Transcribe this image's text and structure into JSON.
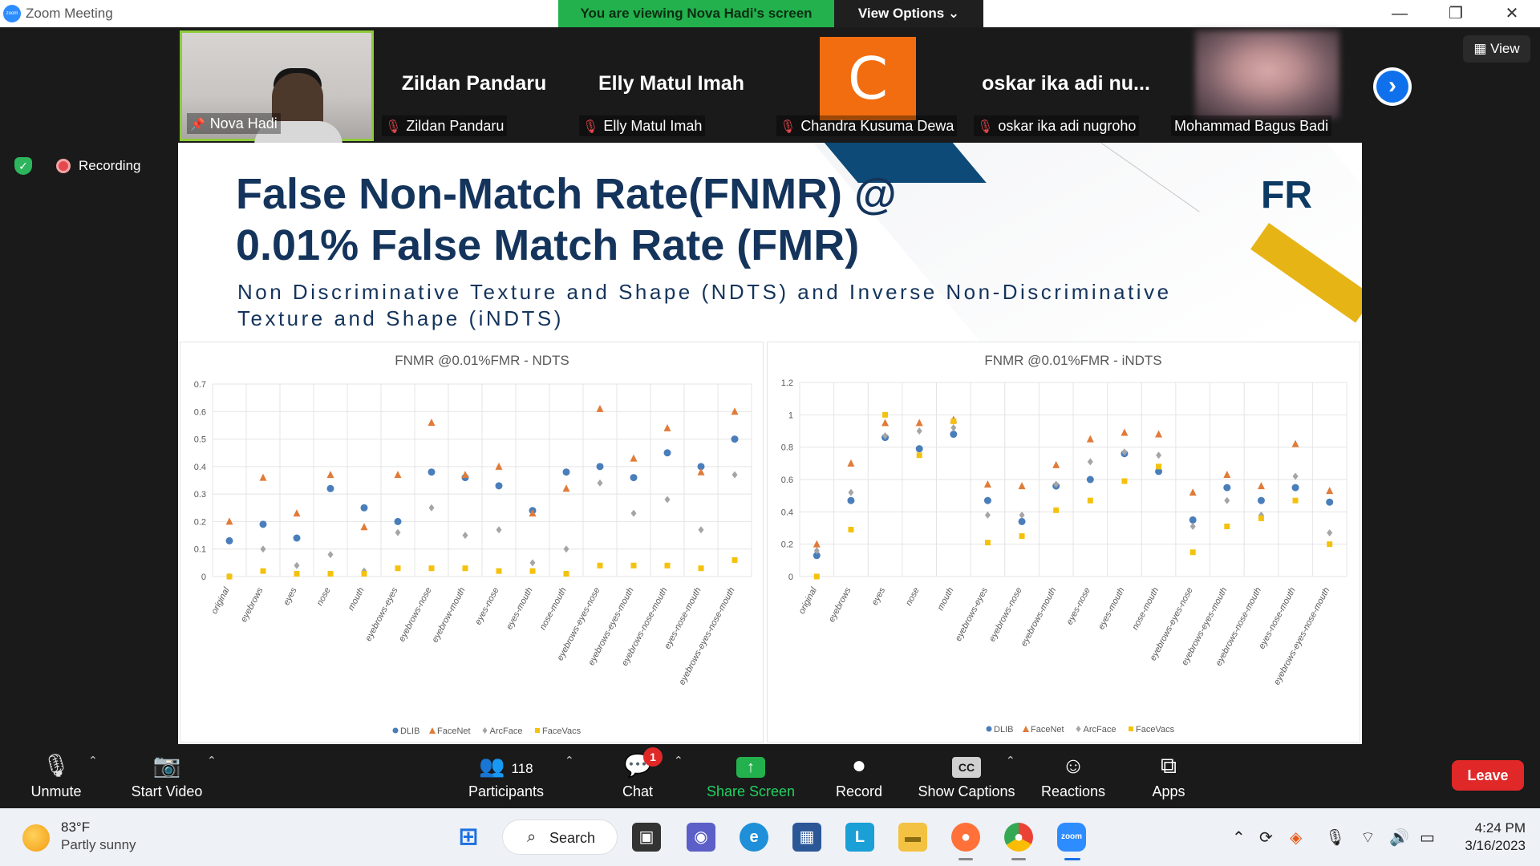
{
  "window": {
    "title": "Zoom Meeting",
    "app_logo_text": "zoom",
    "banner": "You are viewing Nova Hadi's screen",
    "view_options": "View Options",
    "minimize": "—",
    "maximize": "❐",
    "close": "✕"
  },
  "gallery": {
    "view_label": "View",
    "tiles": [
      {
        "name": "Nova Hadi",
        "big": ""
      },
      {
        "name": "Zildan Pandaru",
        "big": "Zildan Pandaru"
      },
      {
        "name": "Elly Matul Imah",
        "big": "Elly Matul Imah"
      },
      {
        "name": "Chandra Kusuma Dewa",
        "big": "",
        "avatar_letter": "C"
      },
      {
        "name": "oskar ika adi nugroho",
        "big": "oskar ika adi nu..."
      },
      {
        "name": "Mohammad Bagus Badi",
        "big": ""
      }
    ],
    "next_icon": "›"
  },
  "recording": {
    "label": "Recording"
  },
  "slide": {
    "title_line1": "False Non-Match Rate(FNMR) @",
    "title_line2": "0.01% False Match Rate (FMR)",
    "subtitle": "Non Discriminative Texture and Shape (NDTS) and Inverse Non-Discriminative Texture and Shape (iNDTS)",
    "logo": "FR"
  },
  "colors": {
    "DLIB": "#4a7ebb",
    "FaceNet": "#e07b39",
    "ArcFace": "#a5a5a5",
    "FaceVacs": "#f4c20d"
  },
  "chart_data": [
    {
      "type": "scatter",
      "title": "FNMR @0.01%FMR - NDTS",
      "ylim": [
        0,
        0.7
      ],
      "yticks": [
        0,
        0.1,
        0.2,
        0.3,
        0.4,
        0.5,
        0.6,
        0.7
      ],
      "categories": [
        "original",
        "eyebrows",
        "eyes",
        "nose",
        "mouth",
        "eyebrows-eyes",
        "eyebrows-nose",
        "eyebrow-mouth",
        "eyes-nose",
        "eyes-mouth",
        "nose-mouth",
        "eyebrows-eyes-nose",
        "eyebrows-eyes-mouth",
        "eyebrows-nose-mouth",
        "eyes-nose-mouth",
        "eyebrows-eyes-nose-mouth"
      ],
      "grid": true,
      "legend": "bottom",
      "series": [
        {
          "name": "DLIB",
          "marker": "circle",
          "values": [
            0.13,
            0.19,
            0.14,
            0.32,
            0.25,
            0.2,
            0.38,
            0.36,
            0.33,
            0.24,
            0.38,
            0.4,
            0.36,
            0.45,
            0.4,
            0.5
          ]
        },
        {
          "name": "FaceNet",
          "marker": "triangle",
          "values": [
            0.2,
            0.36,
            0.23,
            0.37,
            0.18,
            0.37,
            0.56,
            0.37,
            0.4,
            0.23,
            0.32,
            0.61,
            0.43,
            0.54,
            0.38,
            0.6
          ]
        },
        {
          "name": "ArcFace",
          "marker": "diamond",
          "values": [
            0.0,
            0.1,
            0.04,
            0.08,
            0.02,
            0.16,
            0.25,
            0.15,
            0.17,
            0.05,
            0.1,
            0.34,
            0.23,
            0.28,
            0.17,
            0.37
          ]
        },
        {
          "name": "FaceVacs",
          "marker": "square",
          "values": [
            0.0,
            0.02,
            0.01,
            0.01,
            0.01,
            0.03,
            0.03,
            0.03,
            0.02,
            0.02,
            0.01,
            0.04,
            0.04,
            0.04,
            0.03,
            0.06
          ]
        }
      ]
    },
    {
      "type": "scatter",
      "title": "FNMR @0.01%FMR - iNDTS",
      "ylim": [
        0,
        1.2
      ],
      "yticks": [
        0,
        0.2,
        0.4,
        0.6,
        0.8,
        1,
        1.2
      ],
      "categories": [
        "original",
        "eyebrows",
        "eyes",
        "nose",
        "mouth",
        "eyebrows-eyes",
        "eyebrows-nose",
        "eyebrows-mouth",
        "eyes-nose",
        "eyes-mouth",
        "nose-mouth",
        "eyebrows-eyes-nose",
        "eyebrows-eyes-mouth",
        "eyebrows-nose-mouth",
        "eyes-nose-mouth",
        "eyebrows-eyes-nose-mouth"
      ],
      "grid": true,
      "legend": "bottom",
      "series": [
        {
          "name": "DLIB",
          "marker": "circle",
          "values": [
            0.13,
            0.47,
            0.86,
            0.79,
            0.88,
            0.47,
            0.34,
            0.56,
            0.6,
            0.76,
            0.65,
            0.35,
            0.55,
            0.47,
            0.55,
            0.46
          ]
        },
        {
          "name": "FaceNet",
          "marker": "triangle",
          "values": [
            0.2,
            0.7,
            0.95,
            0.95,
            0.97,
            0.57,
            0.56,
            0.69,
            0.85,
            0.89,
            0.88,
            0.52,
            0.63,
            0.56,
            0.82,
            0.53
          ]
        },
        {
          "name": "ArcFace",
          "marker": "diamond",
          "values": [
            0.16,
            0.52,
            0.87,
            0.9,
            0.92,
            0.38,
            0.38,
            0.57,
            0.71,
            0.77,
            0.75,
            0.31,
            0.47,
            0.38,
            0.62,
            0.27
          ]
        },
        {
          "name": "FaceVacs",
          "marker": "square",
          "values": [
            0.0,
            0.29,
            1.0,
            0.75,
            0.96,
            0.21,
            0.25,
            0.41,
            0.47,
            0.59,
            0.68,
            0.15,
            0.31,
            0.36,
            0.47,
            0.2
          ]
        }
      ]
    }
  ],
  "toolbar": {
    "unmute": "Unmute",
    "start_video": "Start Video",
    "participants": "Participants",
    "participants_count": "118",
    "chat": "Chat",
    "chat_badge": "1",
    "share_screen": "Share Screen",
    "record": "Record",
    "show_captions": "Show Captions",
    "captions_icon": "CC",
    "reactions": "Reactions",
    "apps": "Apps",
    "leave": "Leave"
  },
  "taskbar": {
    "weather_temp": "83°F",
    "weather_cond": "Partly sunny",
    "search": "Search",
    "time": "4:24 PM",
    "date": "3/16/2023",
    "zoom_icon_text": "zoom",
    "l_icon_text": "L"
  }
}
